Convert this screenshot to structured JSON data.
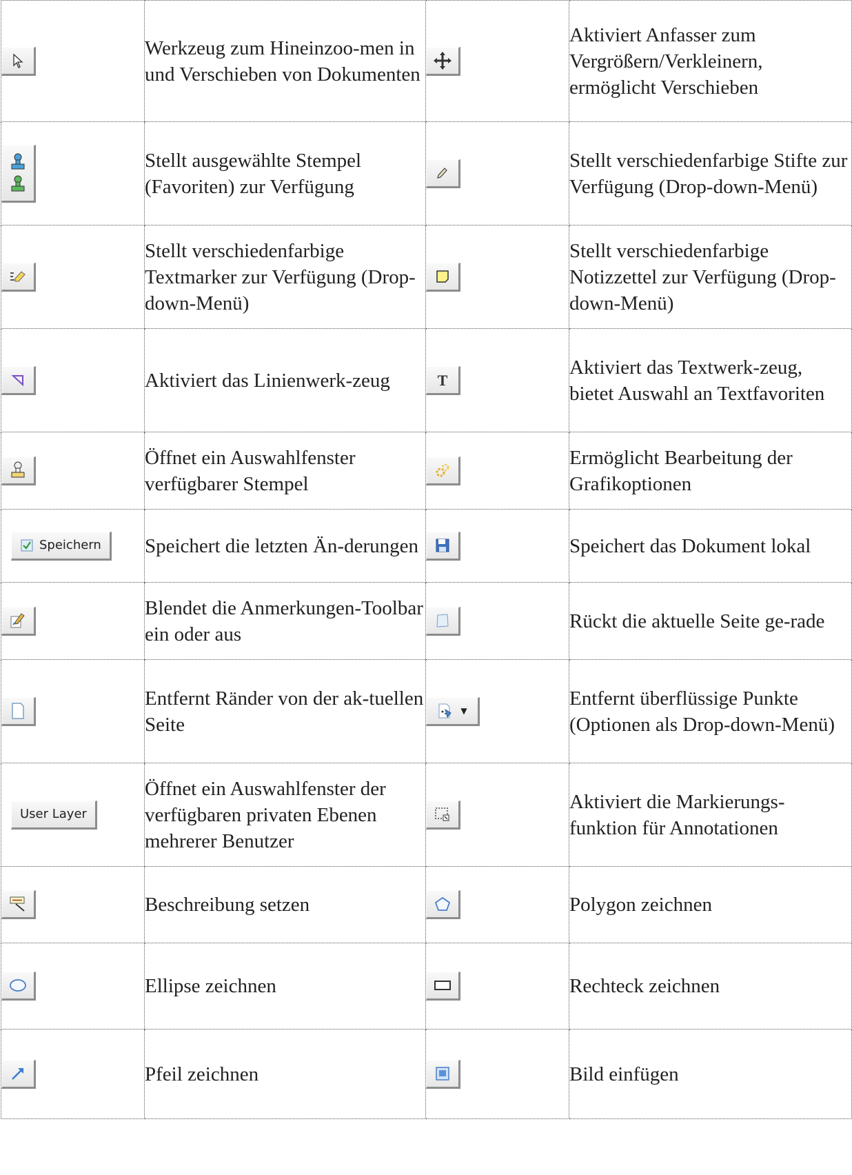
{
  "rows": [
    {
      "left": {
        "icon": "pointer-arrow-icon",
        "text": "Werkzeug zum Hineinzoo-men in und Verschieben von Dokumenten"
      },
      "right": {
        "icon": "move-arrows-icon",
        "text": "Aktiviert Anfasser zum Vergrößern/Verkleinern, ermöglicht Verschieben"
      }
    },
    {
      "left": {
        "icon": "favorite-stamps-icon",
        "text": "Stellt ausgewählte Stempel (Favoriten) zur Verfügung"
      },
      "right": {
        "icon": "pen-icon",
        "text": "Stellt verschiedenfarbige Stifte zur Verfügung (Drop-down-Menü)"
      }
    },
    {
      "left": {
        "icon": "highlighter-icon",
        "text": "Stellt verschiedenfarbige Textmarker zur Verfügung (Drop-down-Menü)"
      },
      "right": {
        "icon": "sticky-note-icon",
        "text": "Stellt verschiedenfarbige Notizzettel zur Verfügung (Drop-down-Menü)"
      }
    },
    {
      "left": {
        "icon": "line-tool-icon",
        "text": "Aktiviert das Linienwerk-zeug"
      },
      "right": {
        "icon": "text-tool-icon",
        "text": "Aktiviert das Textwerk-zeug, bietet Auswahl an Textfavoriten"
      }
    },
    {
      "left": {
        "icon": "stamp-icon",
        "text": "Öffnet ein Auswahlfenster verfügbarer Stempel"
      },
      "right": {
        "icon": "graphic-options-icon",
        "text": "Ermöglicht Bearbeitung der Grafikoptionen"
      }
    },
    {
      "left": {
        "icon": "save-check-icon",
        "button_label": "Speichern",
        "text": "Speichert die letzten Än-derungen"
      },
      "right": {
        "icon": "floppy-disk-icon",
        "text": "Speichert das Dokument lokal"
      }
    },
    {
      "left": {
        "icon": "annotation-toolbar-icon",
        "text": "Blendet die Anmerkungen-Toolbar ein oder aus"
      },
      "right": {
        "icon": "deskew-page-icon",
        "text": "Rückt die aktuelle Seite ge-rade"
      }
    },
    {
      "left": {
        "icon": "blank-page-icon",
        "text": "Entfernt Ränder von der ak-tuellen Seite"
      },
      "right": {
        "icon": "despeckle-icon",
        "text": "Entfernt überflüssige Punkte (Optionen als Drop-down-Menü)"
      }
    },
    {
      "left": {
        "icon": "user-layer-icon",
        "button_label": "User Layer",
        "text": "Öffnet ein Auswahlfenster der verfügbaren privaten Ebenen mehrerer Benutzer"
      },
      "right": {
        "icon": "marquee-select-icon",
        "text": "Aktiviert die Markierungs-funktion für Annotationen"
      }
    },
    {
      "left": {
        "icon": "description-tag-icon",
        "text": "Beschreibung setzen"
      },
      "right": {
        "icon": "polygon-icon",
        "text": "Polygon zeichnen"
      }
    },
    {
      "left": {
        "icon": "ellipse-icon",
        "text": "Ellipse zeichnen"
      },
      "right": {
        "icon": "rectangle-icon",
        "text": "Rechteck zeichnen"
      }
    },
    {
      "left": {
        "icon": "arrow-icon",
        "text": "Pfeil zeichnen"
      },
      "right": {
        "icon": "image-insert-icon",
        "text": "Bild einfügen"
      }
    }
  ]
}
